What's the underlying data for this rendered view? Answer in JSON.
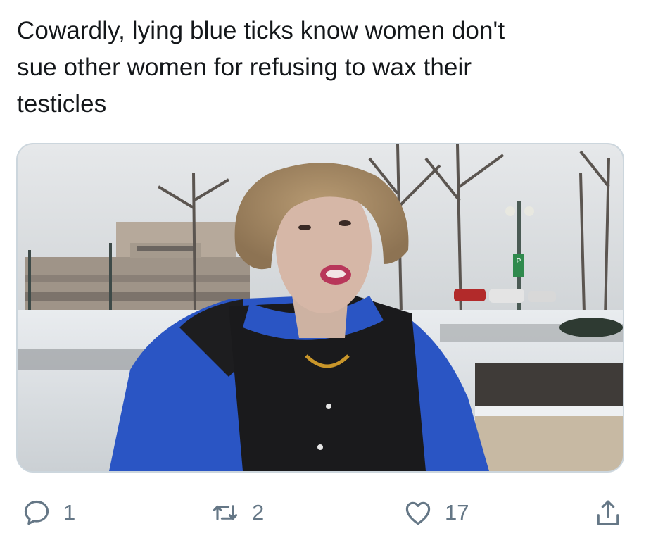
{
  "tweet": {
    "text_lines": [
      "Cowardly, lying blue ticks know women don't",
      "sue other women for refusing to wax their",
      "testicles"
    ]
  },
  "media": {
    "type": "video-thumbnail",
    "signs": {
      "parking_sign_letter": "P"
    }
  },
  "actions": {
    "reply": {
      "icon": "reply-icon",
      "count": "1"
    },
    "retweet": {
      "icon": "retweet-icon",
      "count": "2"
    },
    "like": {
      "icon": "heart-icon",
      "count": "17"
    },
    "share": {
      "icon": "share-icon"
    }
  },
  "colors": {
    "action_gray": "#657786",
    "text": "#14171a",
    "card_border": "#ccd6dd",
    "jacket_blue": "#2a55c4"
  }
}
